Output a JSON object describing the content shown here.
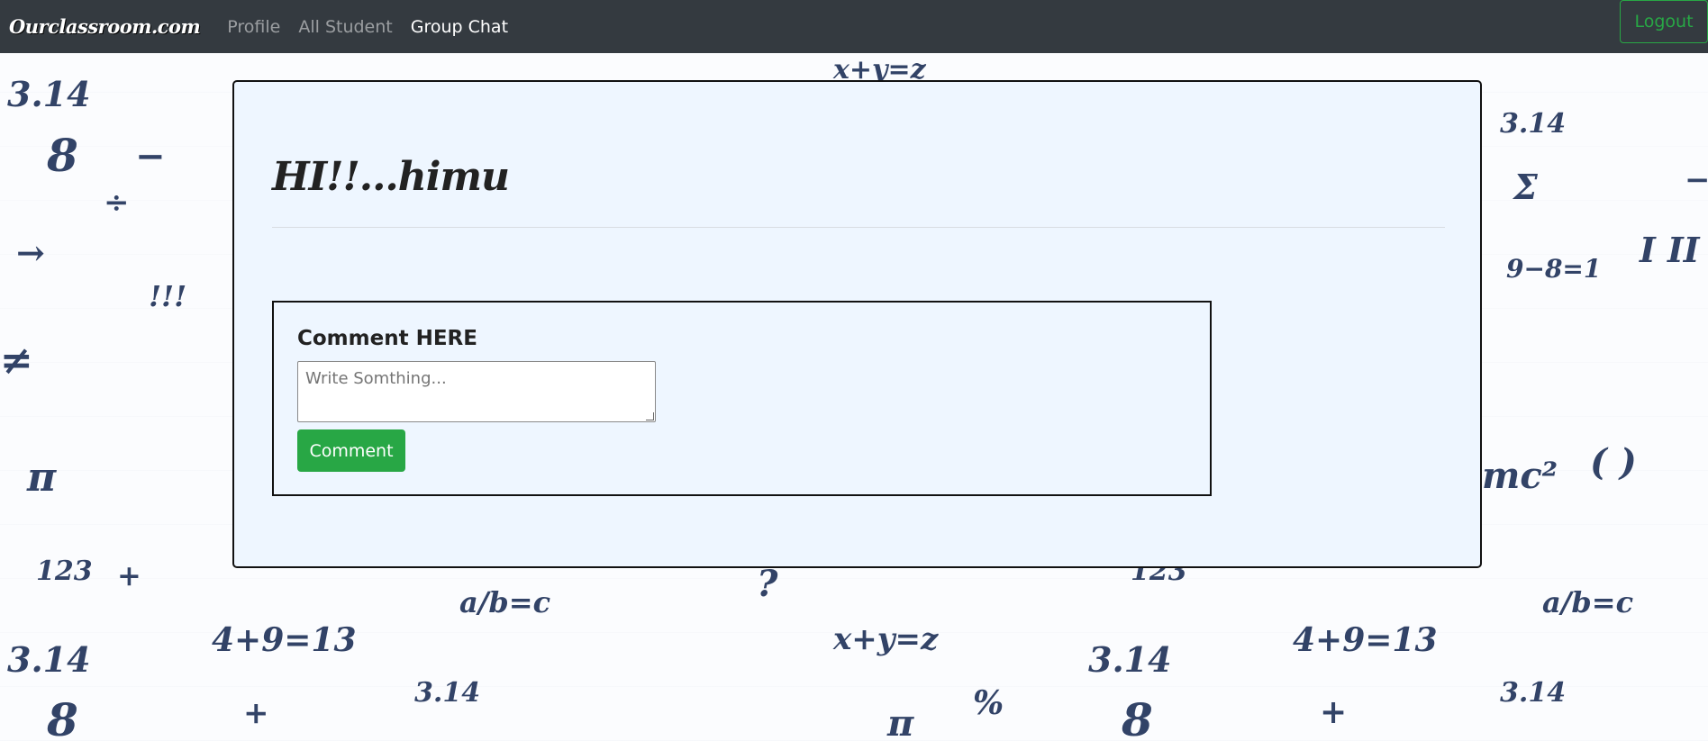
{
  "navbar": {
    "brand": "Ourclassroom.com",
    "links": [
      {
        "label": "Profile",
        "active": false
      },
      {
        "label": "All Student",
        "active": false
      },
      {
        "label": "Group Chat",
        "active": true
      }
    ],
    "logout_label": "Logout"
  },
  "main": {
    "greeting": "HI!!...himu",
    "comment": {
      "title": "Comment HERE",
      "placeholder": "Write Somthing...",
      "value": "",
      "button_label": "Comment"
    }
  },
  "background": {
    "doodles": [
      "3.14",
      "8",
      "−",
      "÷",
      "→",
      "!!!",
      "≠",
      "π",
      "123",
      "+",
      "x+y=z",
      "4+9=13",
      "Σ",
      "9−8=1",
      "mc²",
      "( )",
      "a/b=c",
      "%",
      "?",
      "I II"
    ]
  },
  "colors": {
    "navbar_bg": "#343a40",
    "accent_green": "#28a745",
    "card_bg": "#eef6ff",
    "doodle_ink": "#1d2f57"
  }
}
